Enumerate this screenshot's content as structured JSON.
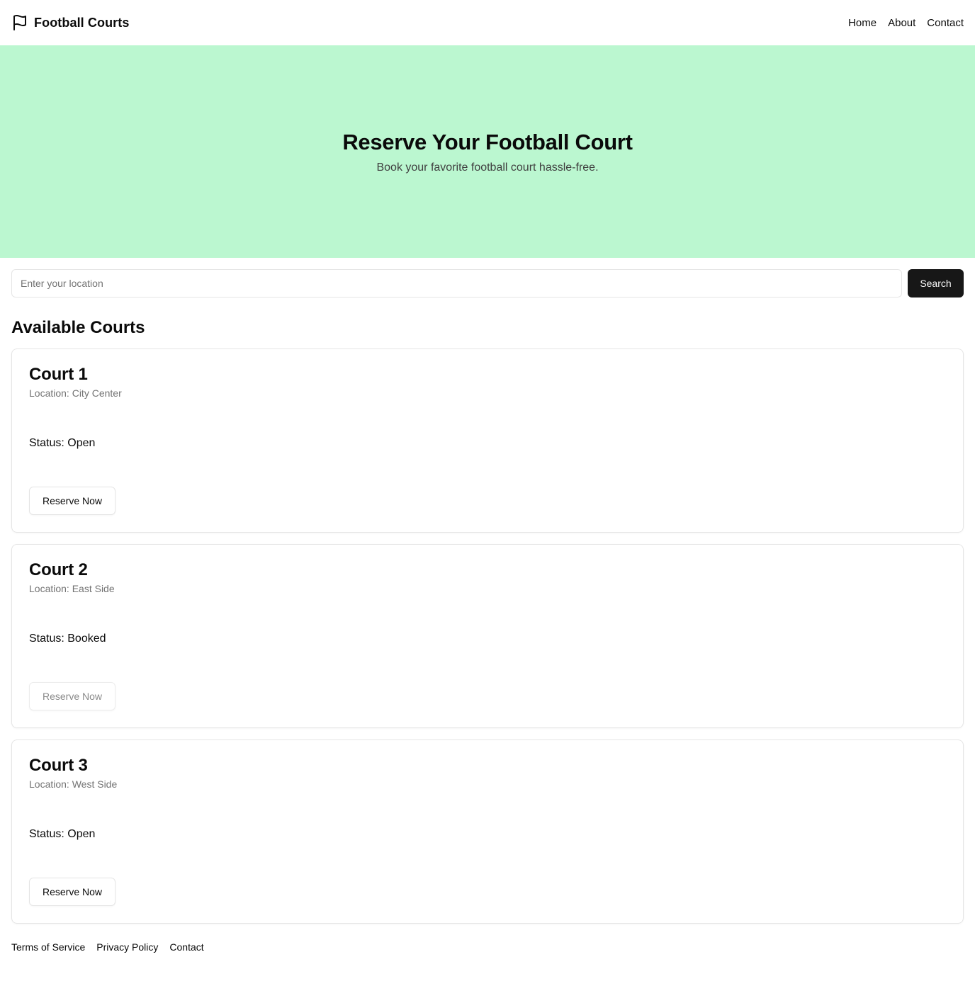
{
  "header": {
    "brand": "Football Courts",
    "nav": [
      "Home",
      "About",
      "Contact"
    ]
  },
  "hero": {
    "title": "Reserve Your Football Court",
    "subtitle": "Book your favorite football court hassle-free."
  },
  "search": {
    "placeholder": "Enter your location",
    "value": "",
    "button_label": "Search"
  },
  "courts_section": {
    "title": "Available Courts",
    "courts": [
      {
        "name": "Court 1",
        "location": "Location: City Center",
        "status": "Status: Open",
        "button_label": "Reserve Now",
        "disabled": false
      },
      {
        "name": "Court 2",
        "location": "Location: East Side",
        "status": "Status: Booked",
        "button_label": "Reserve Now",
        "disabled": true
      },
      {
        "name": "Court 3",
        "location": "Location: West Side",
        "status": "Status: Open",
        "button_label": "Reserve Now",
        "disabled": false
      }
    ]
  },
  "footer": {
    "links": [
      "Terms of Service",
      "Privacy Policy",
      "Contact"
    ]
  },
  "colors": {
    "hero_bg": "#bbf7d0",
    "primary_button": "#171717",
    "muted_text": "#737373",
    "border": "#e5e5e5"
  },
  "icons": {
    "brand": "flag-icon"
  }
}
